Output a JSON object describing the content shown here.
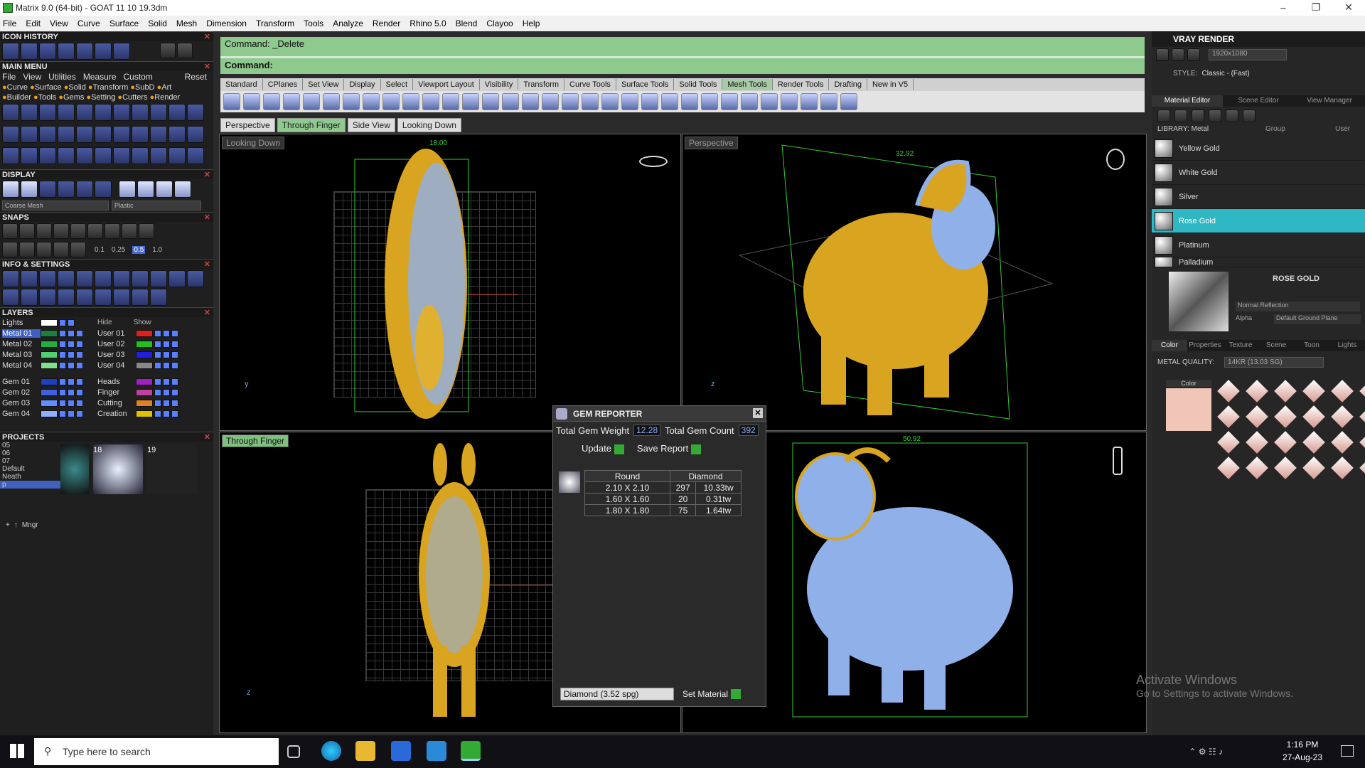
{
  "window": {
    "title": "Matrix 9.0 (64-bit) - GOAT 11 10 19.3dm"
  },
  "menubar": [
    "File",
    "Edit",
    "View",
    "Curve",
    "Surface",
    "Solid",
    "Mesh",
    "Dimension",
    "Transform",
    "Tools",
    "Analyze",
    "Render",
    "Rhino 5.0",
    "Blend",
    "Clayoo",
    "Help"
  ],
  "left": {
    "icon_history": "ICON HISTORY",
    "main_menu": "MAIN MENU",
    "main_menu_items": [
      "File",
      "View",
      "Utilities",
      "Measure",
      "Custom",
      "Reset"
    ],
    "builder_row1": [
      "Curve",
      "Surface",
      "Solid",
      "Transform",
      "SubD",
      "Art"
    ],
    "builder_row2": [
      "Builder",
      "Tools",
      "Gems",
      "Setting",
      "Cutters",
      "Render"
    ],
    "display": "DISPLAY",
    "display_mesh": "Coarse Mesh",
    "display_mat": "Plastic",
    "snaps": "SNAPS",
    "snap_vals": [
      "0.1",
      "0.25",
      "0.5",
      "1.0"
    ],
    "info": "INFO & SETTINGS",
    "layers": "LAYERS",
    "lights": "Lights",
    "hide": "Hide",
    "show": "Show",
    "layer_left": [
      "Metal 01",
      "Metal 02",
      "Metal 03",
      "Metal 04",
      "Gem 01",
      "Gem 02",
      "Gem 03",
      "Gem 04"
    ],
    "layer_right": [
      "User 01",
      "User 02",
      "User 03",
      "User 04",
      "Heads",
      "Finger",
      "Cutting",
      "Creation"
    ],
    "layer_right_colors": [
      "#e02020",
      "#20c020",
      "#2020e0",
      "#888888",
      "#a020c0",
      "#c040a0",
      "#e08020",
      "#e0c000"
    ],
    "layer_left_colors": [
      "#1a7f40",
      "#20b040",
      "#50d070",
      "#80e090",
      "#2040c0",
      "#4060e0",
      "#6090ff",
      "#90b0ff"
    ],
    "projects": "PROJECTS",
    "project_list": [
      "05",
      "06",
      "07",
      "Default",
      "Neath",
      "p"
    ],
    "project_nums": [
      "18",
      "19"
    ],
    "mngr": "Mngr"
  },
  "command": {
    "line1": "Command: _Delete",
    "line2": "Command:"
  },
  "tabs": [
    "Standard",
    "CPlanes",
    "Set View",
    "Display",
    "Select",
    "Viewport Layout",
    "Visibility",
    "Transform",
    "Curve Tools",
    "Surface Tools",
    "Solid Tools",
    "Mesh Tools",
    "Render Tools",
    "Drafting",
    "New in V5"
  ],
  "tabs_active": "Mesh Tools",
  "viewtabs": [
    "Perspective",
    "Through Finger",
    "Side View",
    "Looking Down"
  ],
  "viewtabs_active": "Through Finger",
  "viewports": {
    "tl": "Looking Down",
    "tr": "Perspective",
    "bl": "Through Finger",
    "tl_dim": "18.00",
    "tr_dim": "32.92",
    "br_dim": "50.92"
  },
  "gem": {
    "title": "GEM REPORTER",
    "weight_label": "Total Gem Weight",
    "weight": "12.28",
    "count_label": "Total Gem Count",
    "count": "392",
    "update": "Update",
    "save": "Save Report",
    "col_shape": "Round",
    "col_type": "Diamond",
    "rows": [
      {
        "size": "2.10 X 2.10",
        "qty": "297",
        "tw": "10.33tw"
      },
      {
        "size": "1.60 X 1.60",
        "qty": "20",
        "tw": "0.31tw"
      },
      {
        "size": "1.80 X 1.80",
        "qty": "75",
        "tw": "1.64tw"
      }
    ],
    "material": "Diamond    (3.52 spg)",
    "set_material": "Set Material"
  },
  "right": {
    "title": "VRAY RENDER",
    "resolution": "1920x1080",
    "style_label": "STYLE:",
    "style": "Classic - (Fast)",
    "tabs": [
      "Material Editor",
      "Scene Editor",
      "View Manager"
    ],
    "library": "LIBRARY: Metal",
    "group": "Group",
    "user": "User",
    "materials": [
      "Yellow Gold",
      "White Gold",
      "Silver",
      "Rose Gold",
      "Platinum",
      "Palladium"
    ],
    "selected_material": "Rose Gold",
    "preview_name": "ROSE GOLD",
    "reflection": "Normal Reflection",
    "alpha": "Alpha",
    "ground": "Default Ground Plane",
    "subtabs": [
      "Color",
      "Properties",
      "Texture",
      "Scene",
      "Toon",
      "Lights"
    ],
    "quality_label": "METAL QUALITY:",
    "quality": "14KR        (13.03 SG)",
    "color_label": "Color",
    "swatch_color": "#f0c6b8"
  },
  "watermark": {
    "line1": "Activate Windows",
    "line2": "Go to Settings to activate Windows."
  },
  "taskbar": {
    "search": "Type here to search",
    "time": "1:16 PM",
    "date": "27-Aug-23"
  }
}
